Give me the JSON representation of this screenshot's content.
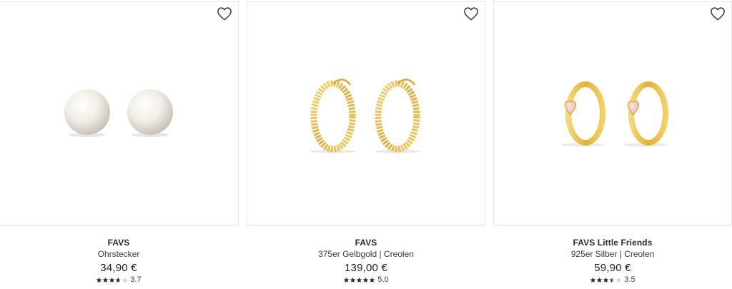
{
  "products": [
    {
      "brand": "FAVS",
      "subtitle": "Ohrstecker",
      "price": "34,90 €",
      "rating": 3.7,
      "rating_label": "3.7",
      "image": "pearl-stud-earrings",
      "wishlist_icon": "heart-outline-icon"
    },
    {
      "brand": "FAVS",
      "subtitle": "375er Gelbgold | Creolen",
      "price": "139,00 €",
      "rating": 5.0,
      "rating_label": "5.0",
      "image": "gold-hoop-earrings",
      "wishlist_icon": "heart-outline-icon"
    },
    {
      "brand": "FAVS Little Friends",
      "subtitle": "925er Silber | Creolen",
      "price": "59,90 €",
      "rating": 3.5,
      "rating_label": "3.5",
      "image": "gold-huggie-heart-earrings",
      "wishlist_icon": "heart-outline-icon"
    }
  ],
  "colors": {
    "star_filled": "#2b2b2b",
    "star_empty": "#d2d2d2",
    "gold": "#e2b93f",
    "pink": "#f4c9c9"
  }
}
